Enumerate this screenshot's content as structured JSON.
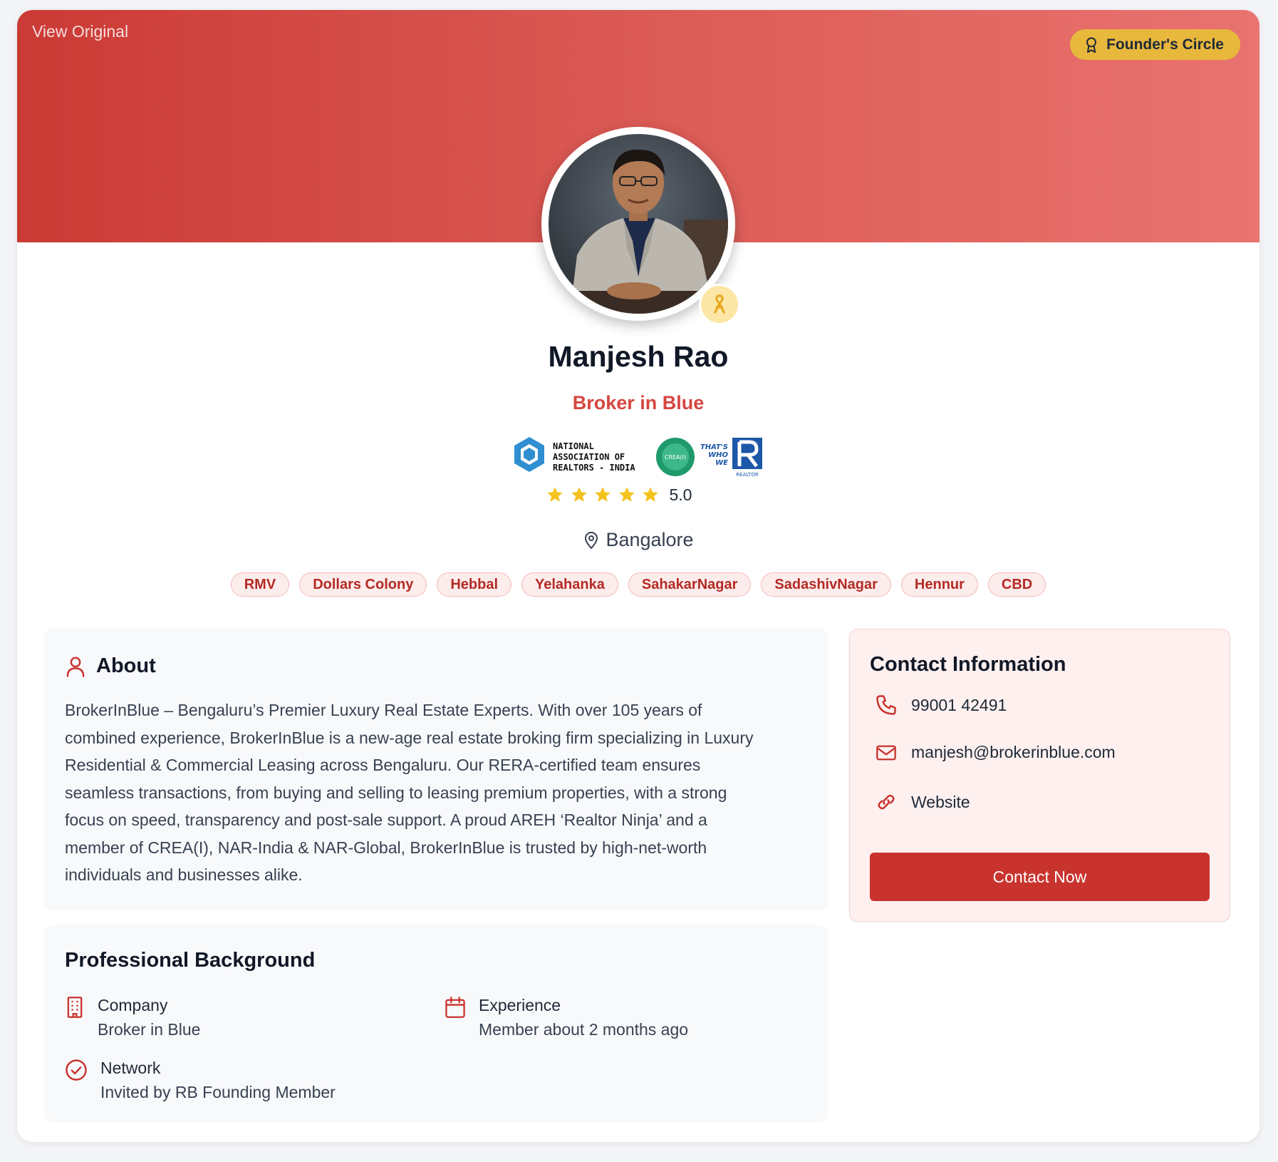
{
  "header": {
    "view_original": "View Original",
    "founder_badge": "Founder's Circle"
  },
  "profile": {
    "name": "Manjesh Rao",
    "subtitle": "Broker in Blue",
    "rating": "5.0",
    "rating_stars": 5,
    "location": "Bangalore",
    "tags": [
      "RMV",
      "Dollars Colony",
      "Hebbal",
      "Yelahanka",
      "SahakarNagar",
      "SadashivNagar",
      "Hennur",
      "CBD"
    ]
  },
  "logos": {
    "nar_india": [
      "NATIONAL",
      "ASSOCIATION OF",
      "REALTORS - INDIA"
    ],
    "crea": "CREA(I)",
    "realtor_tagline": [
      "THAT'S",
      "WHO",
      "WE"
    ],
    "realtor_word": "REALTOR"
  },
  "about": {
    "title": "About",
    "lines": [
      "BrokerInBlue – Bengaluru’s Premier Luxury Real Estate Experts. With over 105 years of",
      "combined experience, BrokerInBlue is a new-age real estate broking firm specializing in Luxury",
      "Residential & Commercial Leasing across Bengaluru. Our RERA-certified team ensures",
      "seamless transactions, from buying and selling to leasing premium properties, with a strong",
      "focus on speed, transparency and post-sale support. A proud AREH ‘Realtor Ninja’ and a",
      "member of CREA(I), NAR-India & NAR-Global, BrokerInBlue is trusted by high-net-worth",
      "individuals and businesses alike."
    ]
  },
  "professional": {
    "title": "Professional Background",
    "company_label": "Company",
    "company_value": "Broker in Blue",
    "experience_label": "Experience",
    "experience_value": "Member about 2 months ago",
    "network_label": "Network",
    "network_value": "Invited by RB Founding Member"
  },
  "contact": {
    "title": "Contact Information",
    "phone": "99001 42491",
    "email": "manjesh@brokerinblue.com",
    "website": "Website",
    "button": "Contact Now"
  },
  "colors": {
    "accent": "#c9332e",
    "badge": "#e8b83d",
    "tag_bg": "#fdecec",
    "tag_text": "#b42a24"
  }
}
